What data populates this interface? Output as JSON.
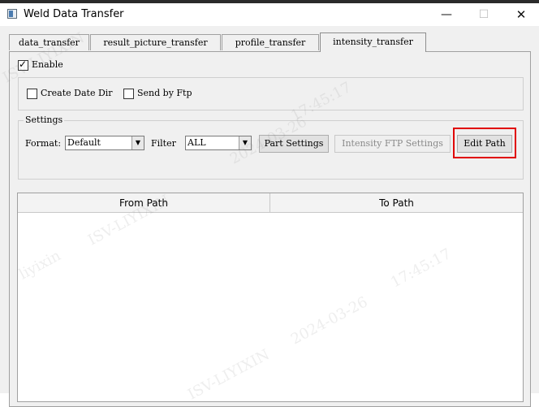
{
  "window": {
    "title": "Weld Data Transfer",
    "min_glyph": "—",
    "max_glyph": "☐",
    "close_glyph": "✕"
  },
  "tabs": [
    {
      "label": "data_transfer",
      "active": false
    },
    {
      "label": "result_picture_transfer",
      "active": false
    },
    {
      "label": "profile_transfer",
      "active": false
    },
    {
      "label": "intensity_transfer",
      "active": true
    }
  ],
  "enable": {
    "label": "Enable",
    "checked": true
  },
  "options": {
    "create_date_dir": {
      "label": "Create Date Dir",
      "checked": false
    },
    "send_by_ftp": {
      "label": "Send by Ftp",
      "checked": false
    }
  },
  "settings": {
    "title": "Settings",
    "format_label": "Format:",
    "format_value": "Default",
    "filter_label": "Filter",
    "filter_value": "ALL",
    "part_settings_button": "Part Settings",
    "intensity_ftp_button": "Intensity FTP Settings",
    "edit_path_button": "Edit Path"
  },
  "table": {
    "columns": [
      "From Path",
      "To Path"
    ],
    "rows": []
  },
  "watermark": {
    "name": "ISV-LIYIXIN",
    "user": "liyixin",
    "date": "2024-03-26",
    "time": "17:45:17"
  },
  "colors": {
    "highlight": "#e00000",
    "background": "#f0f0f0"
  }
}
